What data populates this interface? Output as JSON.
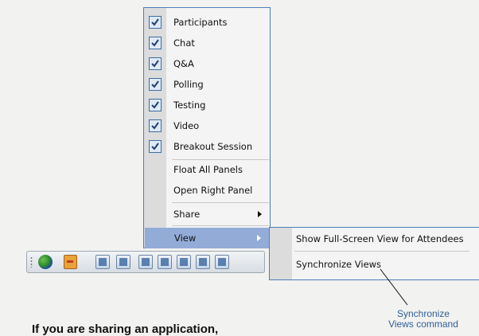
{
  "menu": {
    "checked_items": [
      {
        "label": "Participants",
        "checked": true
      },
      {
        "label": "Chat",
        "checked": true
      },
      {
        "label": "Q&A",
        "checked": true
      },
      {
        "label": "Polling",
        "checked": true
      },
      {
        "label": "Testing",
        "checked": true
      },
      {
        "label": "Video",
        "checked": true
      },
      {
        "label": "Breakout Session",
        "checked": true
      }
    ],
    "float_all_panels": "Float All Panels",
    "open_right_panel": "Open Right Panel",
    "share": "Share",
    "view": "View"
  },
  "submenu": {
    "show_full_screen": "Show Full-Screen View for Attendees",
    "synchronize_views": "Synchronize Views"
  },
  "callout": {
    "line1": "Synchronize",
    "line2": "Views command"
  },
  "body_text": "If you are sharing an application,",
  "colors": {
    "menu_border": "#4a7fb8",
    "highlight": "#93acd7",
    "callout_text": "#2f5f98"
  },
  "icons": [
    "globe-icon",
    "exit-icon",
    "participants-panel-icon",
    "chat-panel-icon",
    "qa-panel-icon",
    "polling-panel-icon",
    "testing-panel-icon",
    "video-panel-icon",
    "breakout-panel-icon"
  ]
}
